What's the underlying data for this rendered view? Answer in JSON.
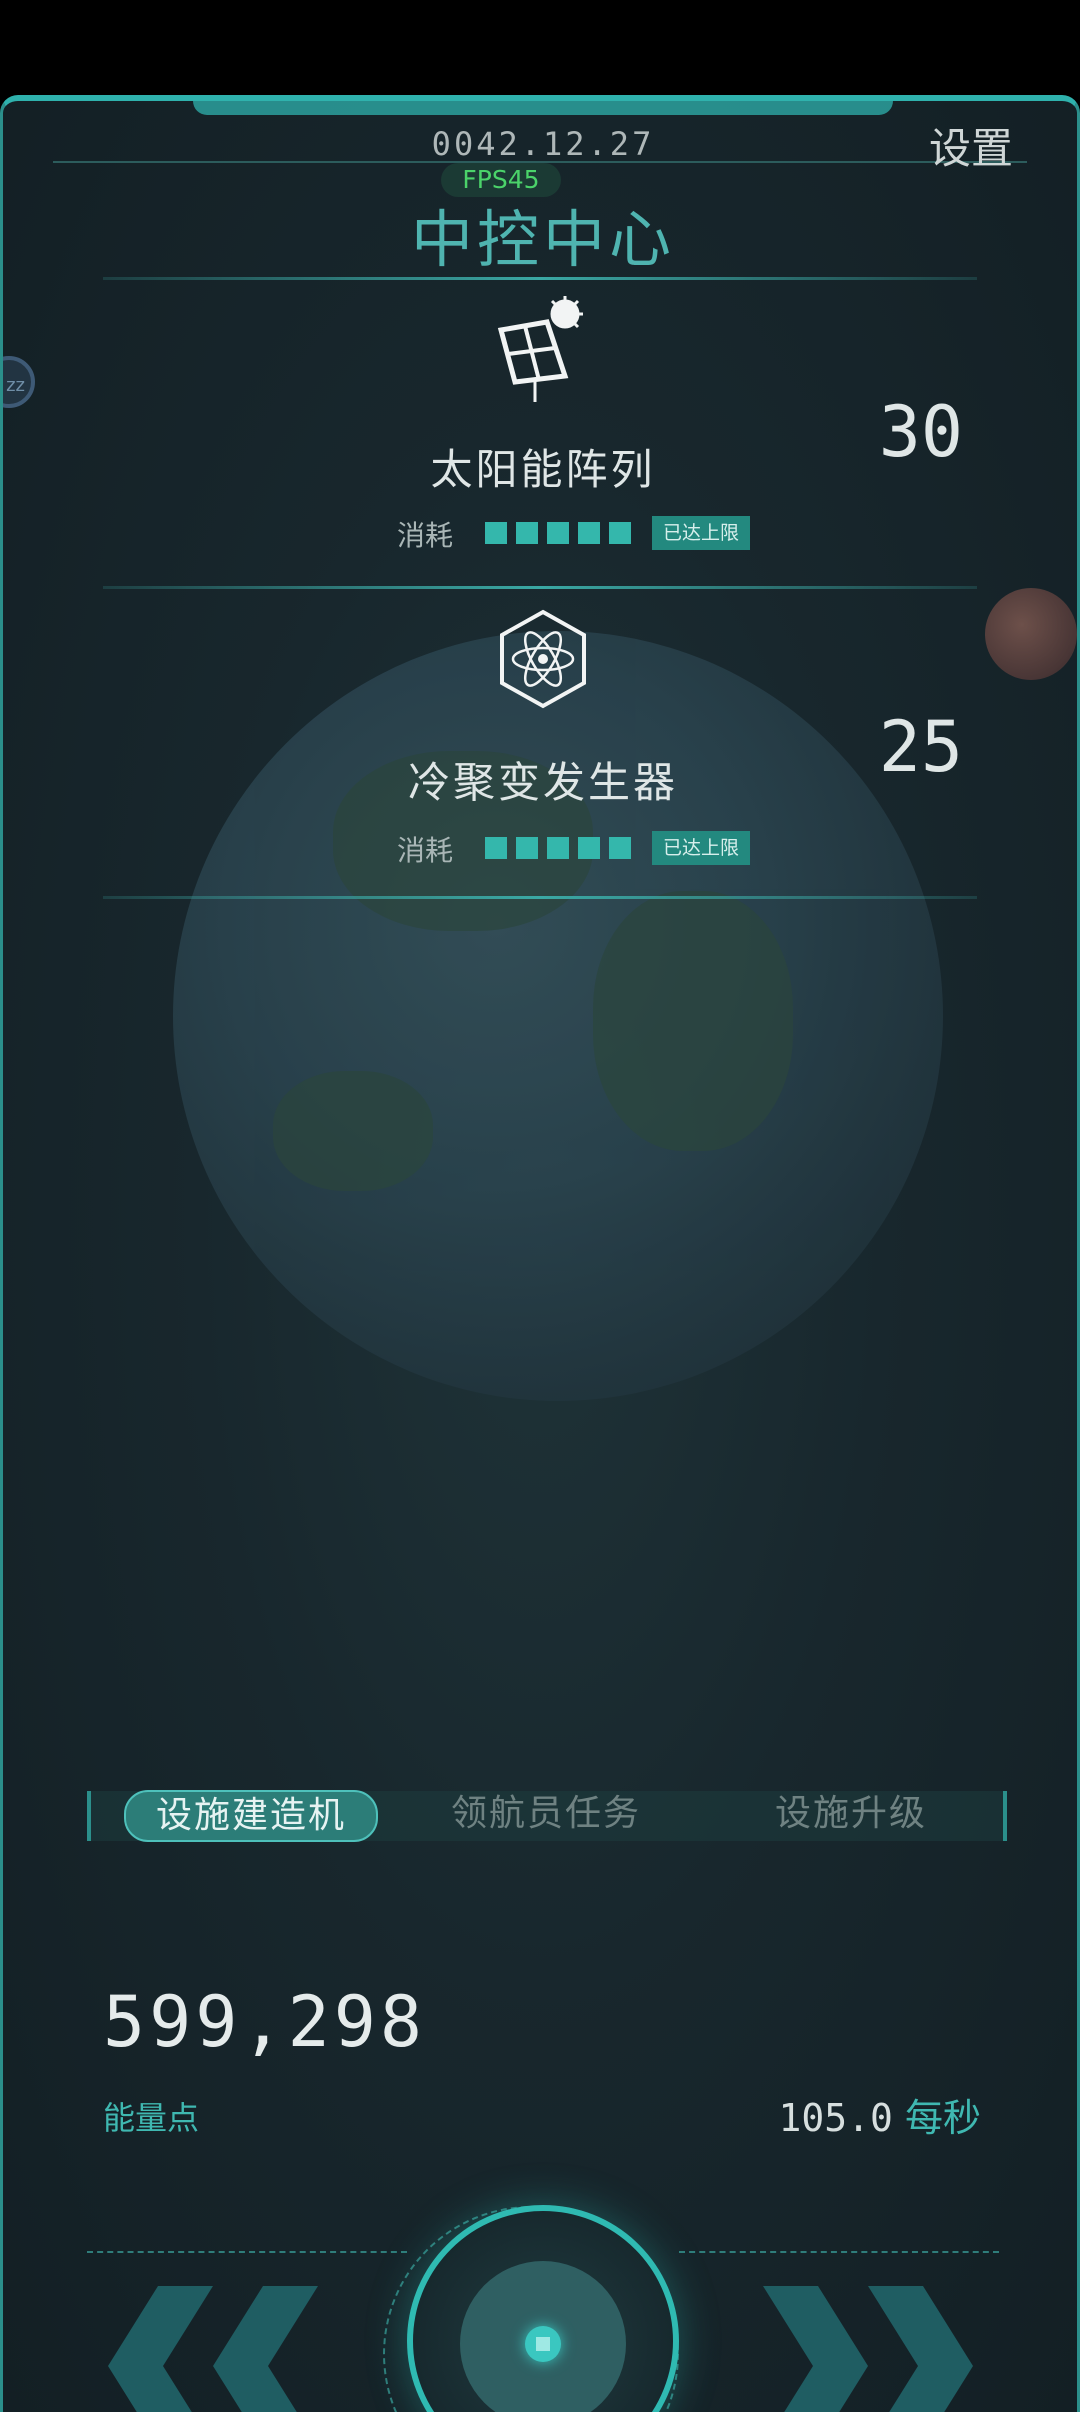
{
  "header": {
    "date": "0042.12.27",
    "fps": "FPS45",
    "settings_label": "设置",
    "title": "中控中心"
  },
  "facilities": [
    {
      "name": "太阳能阵列",
      "count": "30",
      "icon": "solar-panel-icon",
      "consume_label": "消耗",
      "consume_blocks": 5,
      "badge": "已达上限"
    },
    {
      "name": "冷聚变发生器",
      "count": "25",
      "icon": "atom-icon",
      "consume_label": "消耗",
      "consume_blocks": 5,
      "badge": "已达上限"
    }
  ],
  "tabs": [
    {
      "label": "设施建造机",
      "active": true
    },
    {
      "label": "领航员任务",
      "active": false
    },
    {
      "label": "设施升级",
      "active": false
    }
  ],
  "energy": {
    "value": "599,298",
    "label": "能量点",
    "rate_value": "105.0",
    "rate_unit": "每秒"
  },
  "colors": {
    "accent": "#2fb2ad",
    "background": "#18272d",
    "text_light": "#dfe6e6"
  }
}
